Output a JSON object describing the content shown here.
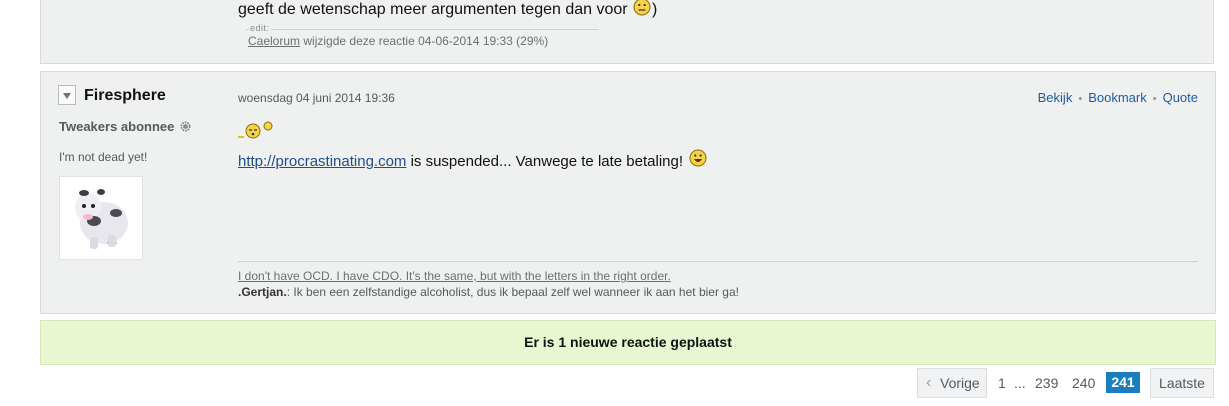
{
  "previous_post": {
    "text_before": "geeft de wetenschap meer argumenten tegen dan voor",
    "text_after": ")",
    "smiley_icon": "neutral-smiley-icon",
    "edit_label": "edit:",
    "edit_user": "Caelorum",
    "edit_text": "wijzigde deze reactie 04-06-2014 19:33 (29%)"
  },
  "post": {
    "username": "Firesphere",
    "status": "Tweakers abonnee",
    "tagline": "I'm not dead yet!",
    "avatar_icon": "cow-avatar-icon",
    "date": "woensdag 04 juni 2014 19:36",
    "actions": [
      "Bekijk",
      "Bookmark",
      "Quote"
    ],
    "emoji_icon": "sleeping-smiley-icon",
    "link_text": "http://procrastinating.com",
    "body_text": "is suspended... Vanwege te late betaling!",
    "body_smiley": "laughing-smiley-icon",
    "signature_line1": "I don't have OCD. I have CDO. It's the same, but with the letters in the right order.",
    "signature_author": ".Gertjan.",
    "signature_line2": ": Ik ben een zelfstandige alcoholist, dus ik bepaal zelf wel wanneer ik aan het bier ga!"
  },
  "notice": {
    "text": "Er is 1 nieuwe reactie geplaatst"
  },
  "pagination": {
    "prev": "Vorige",
    "first": "1",
    "ellipsis": "...",
    "p239": "239",
    "p240": "240",
    "current": "241",
    "last": "Laatste"
  },
  "colors": {
    "link": "#1f5a9e",
    "notice_bg": "#e8f7d0",
    "current_page": "#1a7fc1"
  }
}
